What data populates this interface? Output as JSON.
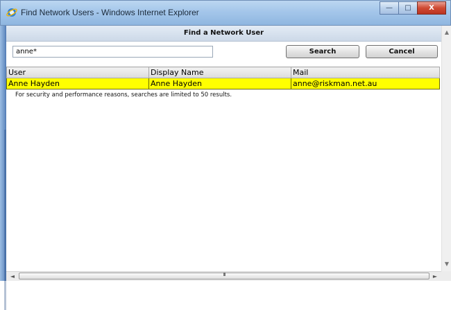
{
  "window": {
    "title": "Find Network Users - Windows Internet Explorer",
    "controls": {
      "minimize": "—",
      "maximize": "□",
      "close": "X"
    }
  },
  "dialog": {
    "header": "Find a Network User",
    "search_value": "anne*",
    "search_button": "Search",
    "cancel_button": "Cancel"
  },
  "results": {
    "columns": [
      "User",
      "Display Name",
      "Mail"
    ],
    "rows": [
      [
        "Anne Hayden",
        "Anne Hayden",
        "anne@riskman.net.au"
      ]
    ],
    "highlight_color": "#ffff00"
  },
  "note": "For security and performance reasons, searches are limited to 50 results.",
  "scrollbars": {
    "vertical_up": "▲",
    "vertical_down": "▼",
    "horizontal_left": "◄",
    "horizontal_right": "►",
    "horizontal_grip": "III"
  },
  "icons": [
    "ie-icon",
    "minimize-icon",
    "maximize-icon",
    "close-icon"
  ]
}
